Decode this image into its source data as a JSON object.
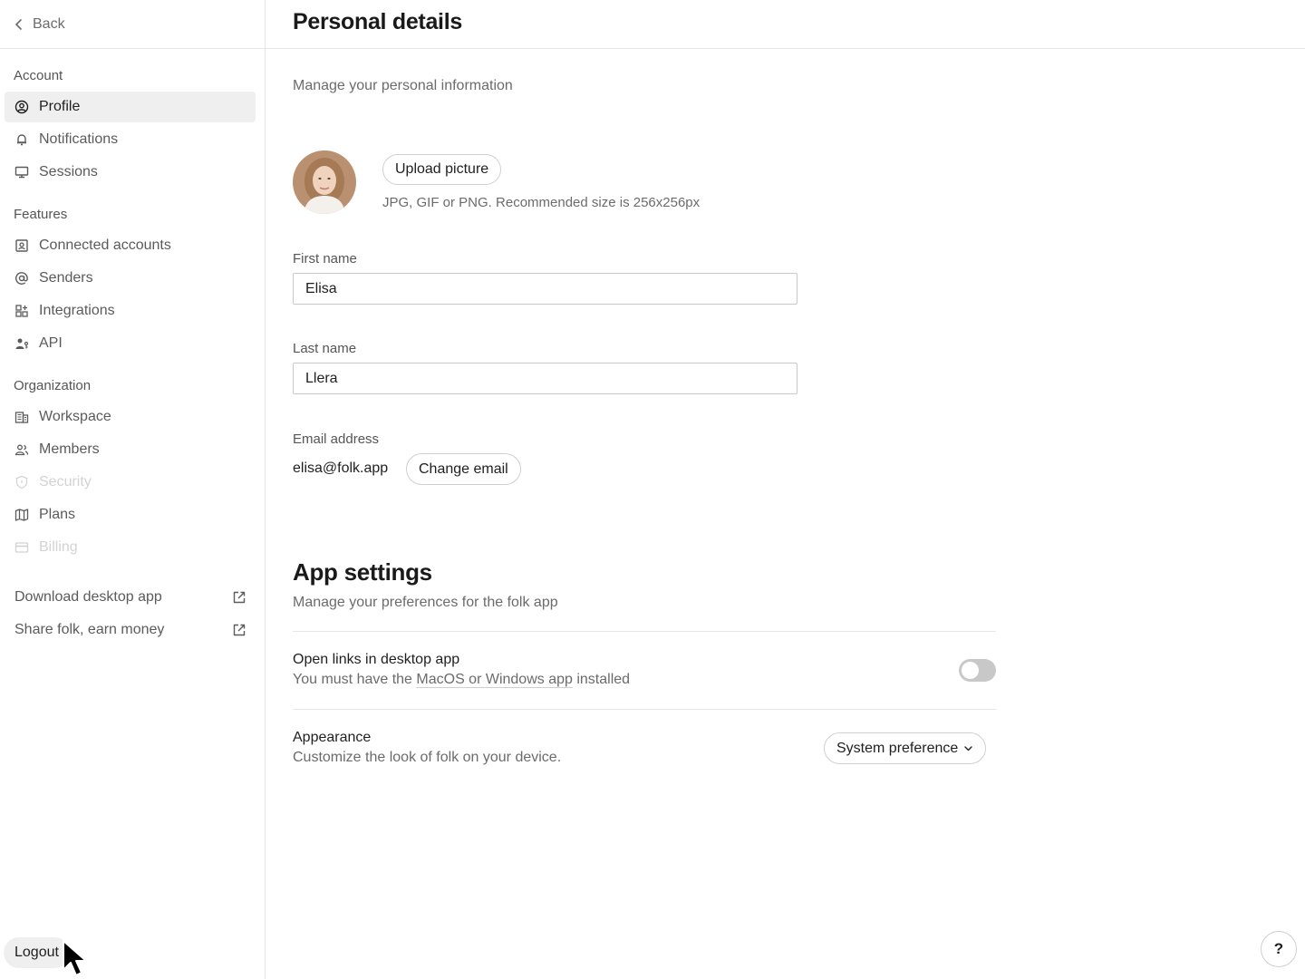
{
  "sidebar": {
    "back_label": "Back",
    "sections": {
      "account": "Account",
      "features": "Features",
      "organization": "Organization"
    },
    "items": {
      "profile": "Profile",
      "notifications": "Notifications",
      "sessions": "Sessions",
      "connected_accounts": "Connected accounts",
      "senders": "Senders",
      "integrations": "Integrations",
      "api": "API",
      "workspace": "Workspace",
      "members": "Members",
      "security": "Security",
      "plans": "Plans",
      "billing": "Billing"
    },
    "links": {
      "download": "Download desktop app",
      "share": "Share folk, earn money"
    },
    "logout_label": "Logout"
  },
  "header": {
    "title": "Personal details"
  },
  "personal": {
    "subtitle": "Manage your personal information",
    "upload_label": "Upload picture",
    "upload_hint": "JPG, GIF or PNG. Recommended size is 256x256px",
    "first_name_label": "First name",
    "first_name_value": "Elisa",
    "last_name_label": "Last name",
    "last_name_value": "Llera",
    "email_label": "Email address",
    "email_value": "elisa@folk.app",
    "change_email_label": "Change email"
  },
  "app_settings": {
    "title": "App settings",
    "subtitle": "Manage your preferences for the folk app",
    "open_links_title": "Open links in desktop app",
    "open_links_desc_prefix": "You must have the ",
    "open_links_desc_link": "MacOS or Windows app",
    "open_links_desc_suffix": " installed",
    "open_links_enabled": false,
    "appearance_title": "Appearance",
    "appearance_desc": "Customize the look of folk on your device.",
    "appearance_value": "System preference"
  },
  "help_label": "?",
  "colors": {
    "active_bg": "#efefef",
    "border": "#e6e6e6",
    "muted_text": "#6b6b6b",
    "toggle_off": "#c8c8c8"
  }
}
